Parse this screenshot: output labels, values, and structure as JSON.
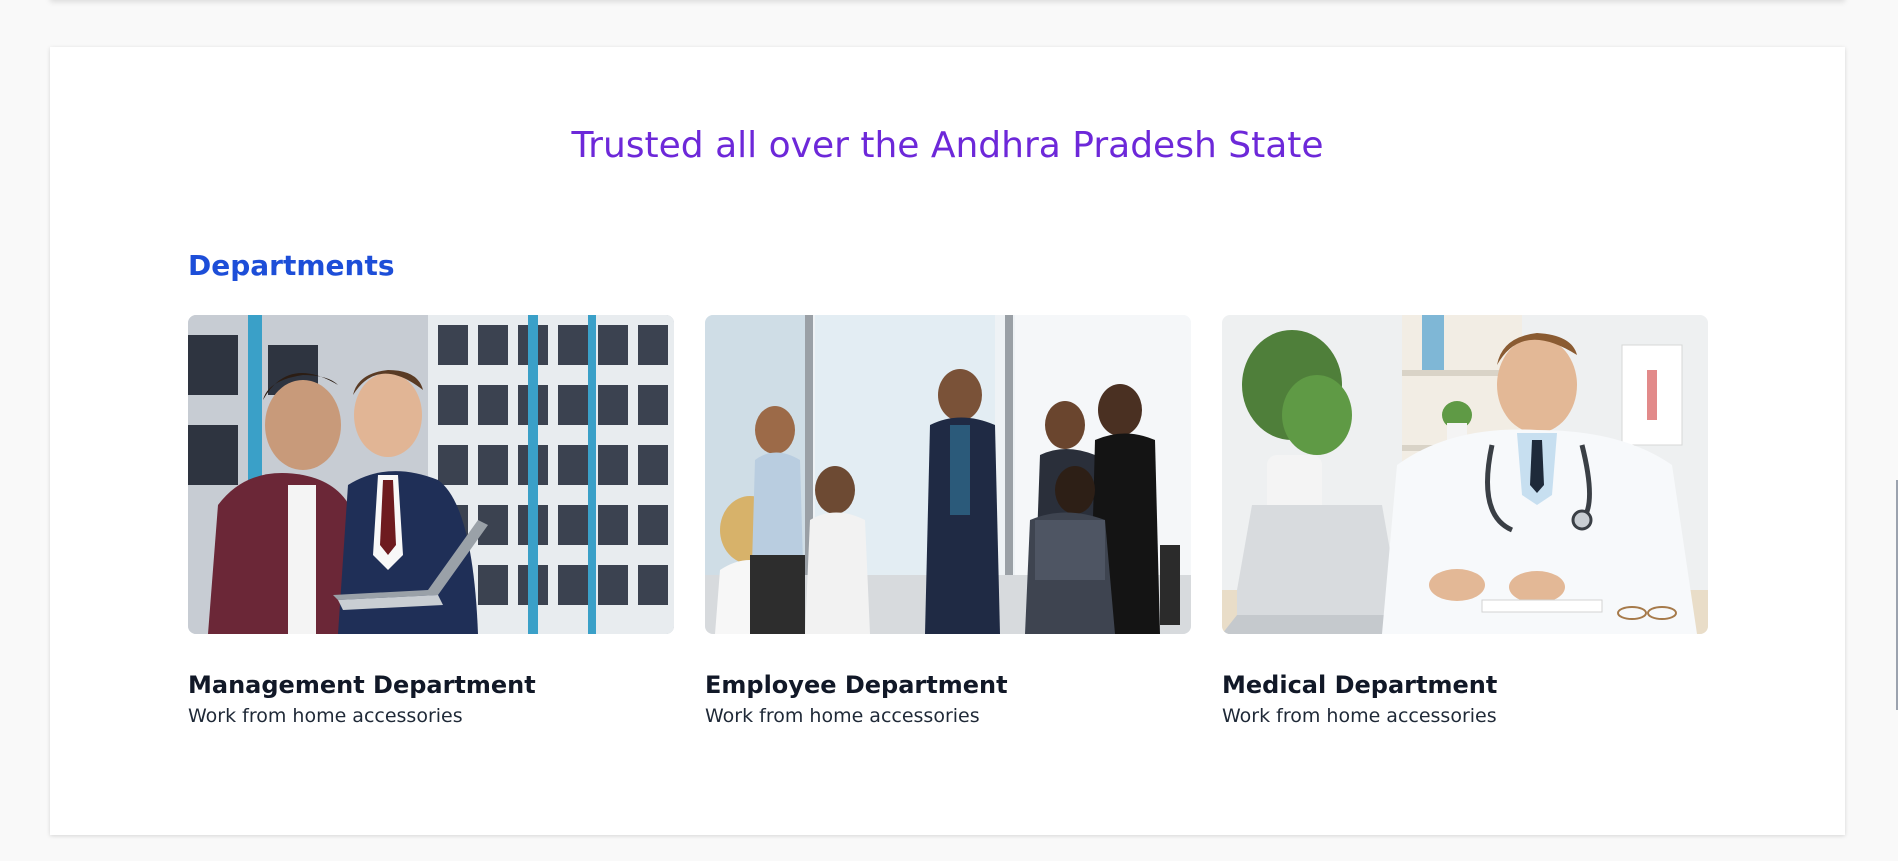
{
  "hero": {
    "title": "Trusted all over the Andhra Pradesh State"
  },
  "departments": {
    "heading": "Departments",
    "items": [
      {
        "name": "Management Department",
        "description": "Work from home accessories",
        "image_alt": "Two colleagues reviewing a laptop in a server room"
      },
      {
        "name": "Employee Department",
        "description": "Work from home accessories",
        "image_alt": "Team meeting with colleagues in an office"
      },
      {
        "name": "Medical Department",
        "description": "Work from home accessories",
        "image_alt": "Smiling doctor with stethoscope at a desk with laptop"
      }
    ]
  },
  "colors": {
    "title": "#6d28d9",
    "heading": "#1d4ed8",
    "text": "#111827"
  }
}
